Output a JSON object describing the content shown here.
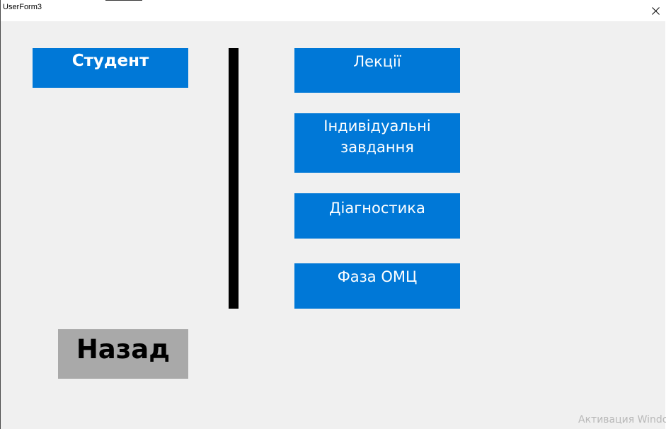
{
  "window": {
    "title": "UserForm3"
  },
  "form": {
    "student_label": "Студент",
    "menu": {
      "lectures": "Лекції",
      "individual_tasks_line1": "Індивідуальні",
      "individual_tasks_line2": "завдання",
      "diagnostics": "Діагностика",
      "omc_phase": "Фаза ОМЦ"
    },
    "back_label": "Назад"
  },
  "system": {
    "activation_watermark": "Активация Windows"
  },
  "icons": {
    "close": "close-icon"
  },
  "colors": {
    "accent_blue": "#0078d7",
    "back_button_gray": "#a9a9a9",
    "divider": "#000000",
    "form_background": "#f0f0f0"
  }
}
